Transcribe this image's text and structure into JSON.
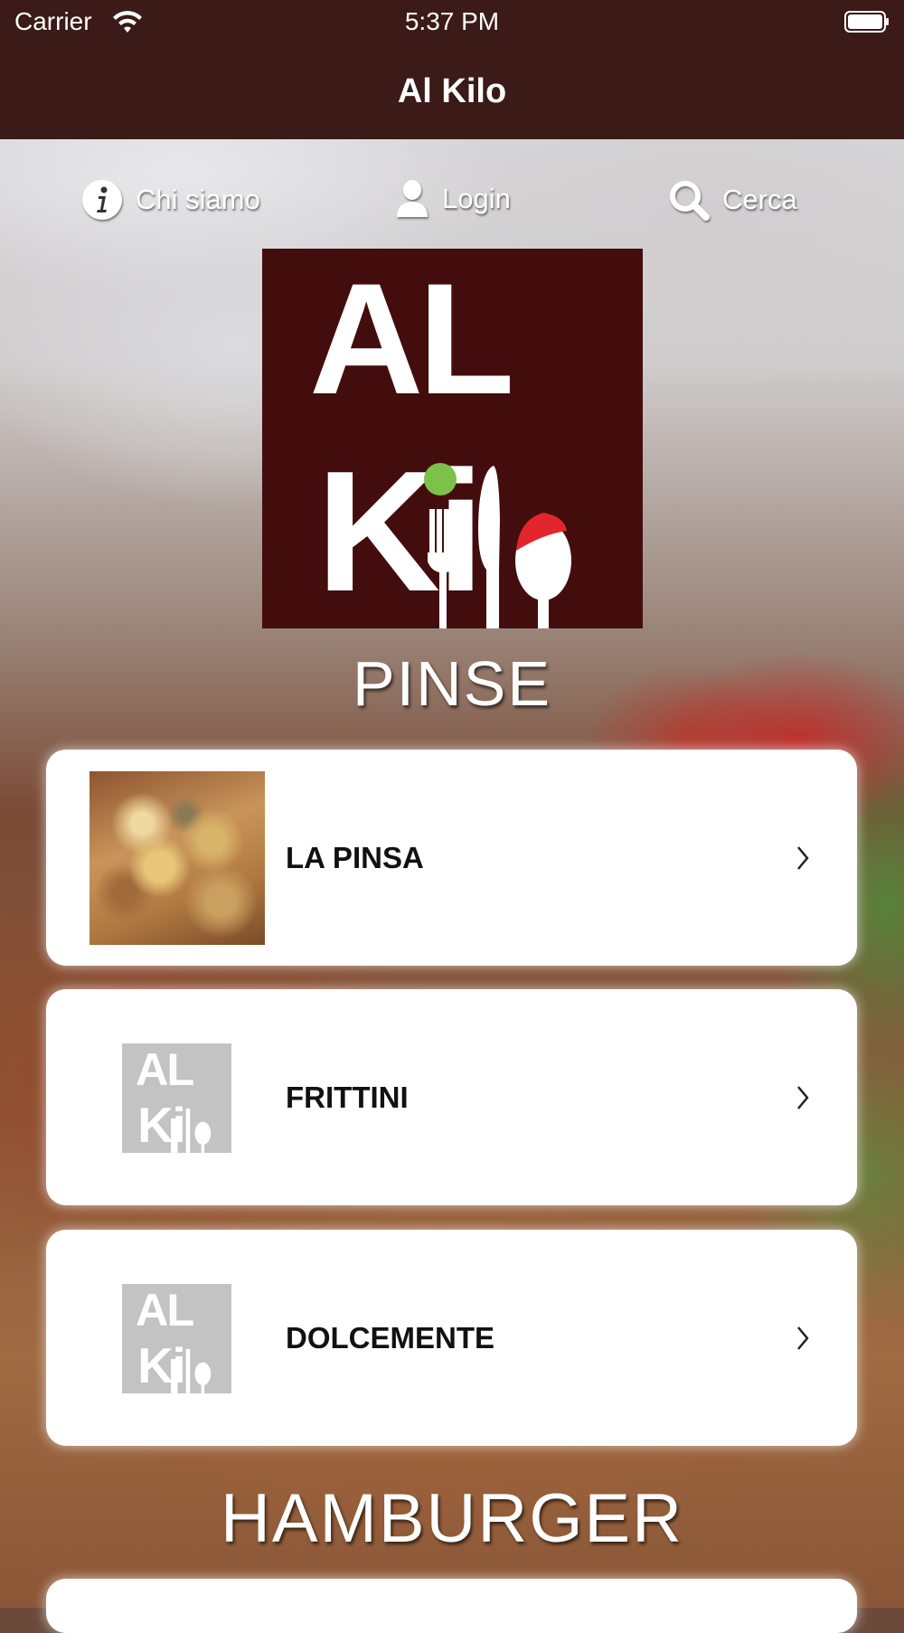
{
  "status_bar": {
    "carrier": "Carrier",
    "time": "5:37 PM"
  },
  "nav": {
    "title": "Al Kilo"
  },
  "top_links": [
    {
      "label": "Chi siamo",
      "icon": "info-icon"
    },
    {
      "label": "Login",
      "icon": "user-icon"
    },
    {
      "label": "Cerca",
      "icon": "search-icon"
    }
  ],
  "logo": {
    "line1": "AL",
    "line2": "Ki",
    "text_end": "lo"
  },
  "sections": [
    {
      "title": "PINSE",
      "items": [
        {
          "label": "LA PINSA",
          "image": "pinsa-photo"
        },
        {
          "label": "FRITTINI",
          "image": "al-kilo-placeholder-logo"
        },
        {
          "label": "DOLCEMENTE",
          "image": "al-kilo-placeholder-logo"
        }
      ]
    },
    {
      "title": "HAMBURGER",
      "items": []
    }
  ],
  "colors": {
    "bar_background": "#3b1a17",
    "logo_background": "#440d0d",
    "logo_green": "#7cc24a",
    "logo_red": "#e3262e",
    "card_background": "#ffffff"
  }
}
